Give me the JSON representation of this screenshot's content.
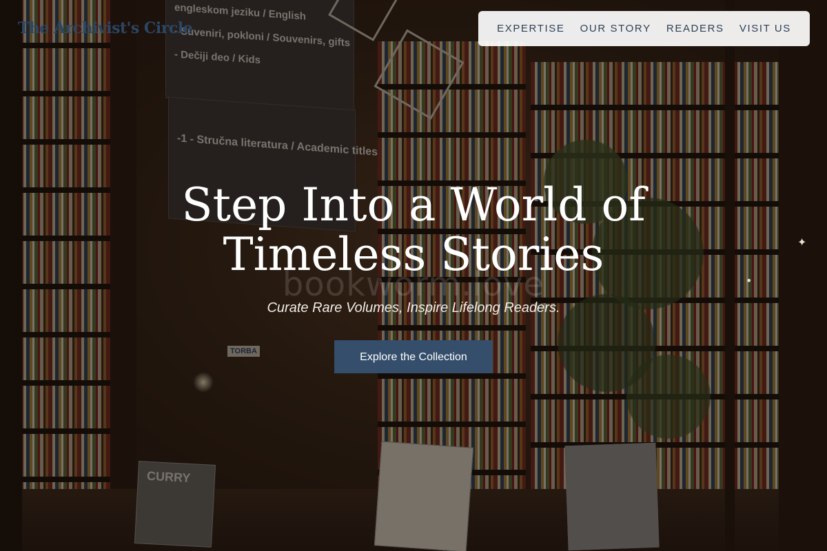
{
  "brand": {
    "name": "The Archivist's Circle"
  },
  "nav": {
    "items": [
      {
        "label": "EXPERTISE"
      },
      {
        "label": "OUR STORY"
      },
      {
        "label": "READERS"
      },
      {
        "label": "VISIT US"
      }
    ]
  },
  "hero": {
    "title_line1": "Step Into a World of",
    "title_line2": "Timeless Stories",
    "watermark": "bookworm.love",
    "subtitle": "Curate Rare Volumes, Inspire Lifelong Readers.",
    "cta_label": "Explore the Collection"
  },
  "scene": {
    "sign_top_lines": [
      "engleskom jeziku / English",
      "- Suveniri, pokloni / Souvenirs, gifts",
      "- Dečiji deo / Kids"
    ],
    "sign_mid_lines": [
      "-1  - Stručna literatura / Academic titles"
    ],
    "book_left_title": "CURRY",
    "stand_label": "TORBA"
  },
  "colors": {
    "accent": "#344e6b",
    "nav_text": "#2d4157",
    "brand": "#2c4666"
  }
}
